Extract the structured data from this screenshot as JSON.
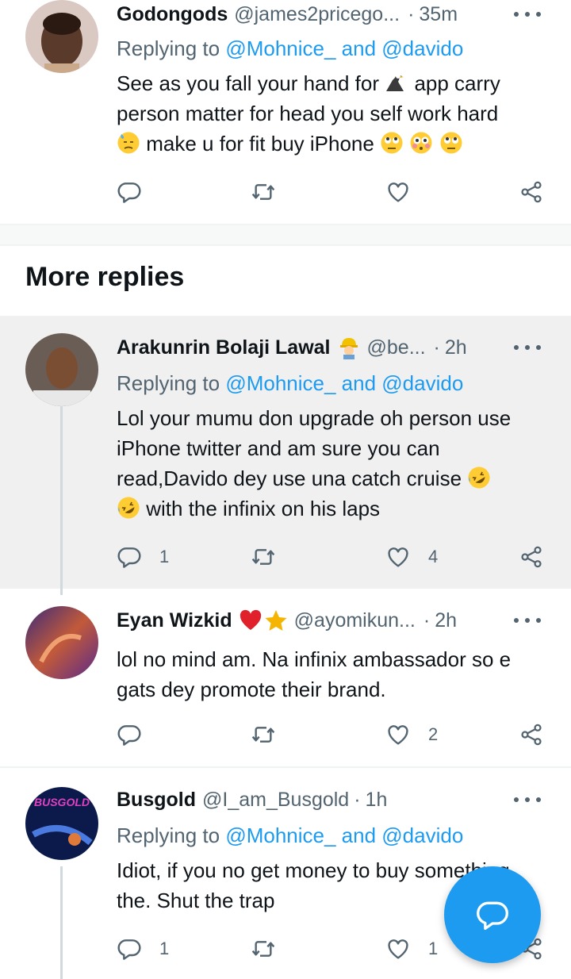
{
  "colors": {
    "accent": "#1d9bf0",
    "muted": "#536471",
    "text": "#0f1419",
    "highlight_bg": "#f0f0f0"
  },
  "section_title": "More replies",
  "tweets": [
    {
      "name": "Godongods",
      "badge_icons": [],
      "handle": "@james2pricego...",
      "time": "35m",
      "replying_prefix": "Replying to",
      "replying_mentions": "@Mohnice_ and @davido",
      "text_lines": [
        "See as you fall your hand for",
        "app carry",
        "person matter for head  you self work hard",
        "make u for fit buy iPhone"
      ],
      "emoji": [
        "eagle-emoji",
        "downcast-sweat-emoji",
        "rolling-eyes-emoji",
        "flushed-emoji",
        "rolling-eyes-emoji"
      ],
      "reply_count": "",
      "retweet_count": "",
      "like_count": ""
    },
    {
      "name": "Arakunrin Bolaji Lawal",
      "badge_icons": [
        "construction-worker-emoji"
      ],
      "handle": "@be...",
      "time": "2h",
      "replying_prefix": "Replying to",
      "replying_mentions": "@Mohnice_ and @davido",
      "text_lines": [
        "Lol your mumu don upgrade oh person use",
        "iPhone twitter and am sure you can",
        "read,Davido dey use una catch cruise",
        "with the infinix on his laps"
      ],
      "emoji": [
        "rofl-emoji",
        "rofl-emoji"
      ],
      "reply_count": "1",
      "retweet_count": "",
      "like_count": "4"
    },
    {
      "name": "Eyan Wizkid",
      "badge_icons": [
        "red-heart-emoji",
        "star-emoji"
      ],
      "handle": "@ayomikun...",
      "time": "2h",
      "text_lines": [
        "lol no mind am. Na infinix ambassador so e",
        "gats dey promote their brand."
      ],
      "reply_count": "",
      "retweet_count": "",
      "like_count": "2"
    },
    {
      "name": "Busgold",
      "badge_icons": [],
      "handle": "@I_am_Busgold",
      "time": "1h",
      "replying_prefix": "Replying to",
      "replying_mentions": "@Mohnice_ and @davido",
      "text_lines": [
        "Idiot, if you no get money to buy something",
        "the. Shut the trap"
      ],
      "avatar_text": "BUSGOLD",
      "reply_count": "1",
      "retweet_count": "",
      "like_count": "1"
    }
  ],
  "fab": {
    "icon": "compose-reply-icon"
  }
}
